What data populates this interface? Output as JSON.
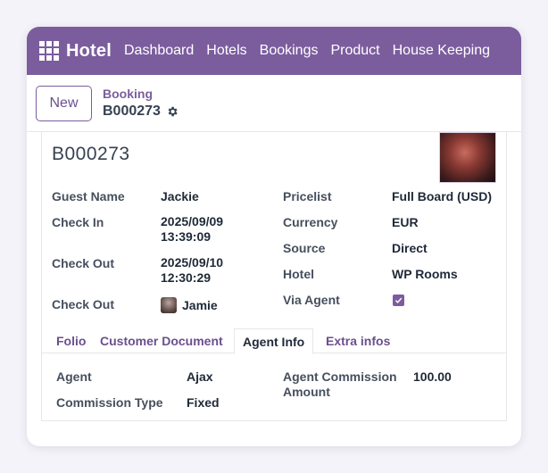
{
  "topbar": {
    "app_icon": "apps-grid-icon",
    "brand": "Hotel",
    "nav": [
      "Dashboard",
      "Hotels",
      "Bookings",
      "Product",
      "House Keeping"
    ],
    "color": "#7b5d9e"
  },
  "controlbar": {
    "new_label": "New",
    "breadcrumb_parent": "Booking",
    "breadcrumb_current": "B000273",
    "settings_icon": "gear-icon"
  },
  "record": {
    "title": "B000273",
    "left_fields": [
      {
        "label": "Guest Name",
        "value": "Jackie"
      },
      {
        "label": "Check In",
        "value": "2025/09/09 13:39:09"
      },
      {
        "label": "Check Out",
        "value": "2025/09/10 12:30:29"
      },
      {
        "label": "Check Out",
        "value": "Jamie"
      }
    ],
    "right_fields": [
      {
        "label": "Pricelist",
        "value": "Full Board (USD)"
      },
      {
        "label": "Currency",
        "value": "EUR"
      },
      {
        "label": "Source",
        "value": "Direct"
      },
      {
        "label": "Hotel",
        "value": "WP Rooms"
      },
      {
        "label": "Via Agent",
        "value": true
      }
    ]
  },
  "tabs": {
    "items": [
      "Folio",
      "Customer Document",
      "Agent Info",
      "Extra infos"
    ],
    "active": "Agent Info"
  },
  "agent_info": {
    "agent_label": "Agent",
    "agent_value": "Ajax",
    "commission_type_label": "Commission Type",
    "commission_type_value": "Fixed",
    "commission_amount_label": "Agent Commission Amount",
    "commission_amount_value": "100.00"
  }
}
